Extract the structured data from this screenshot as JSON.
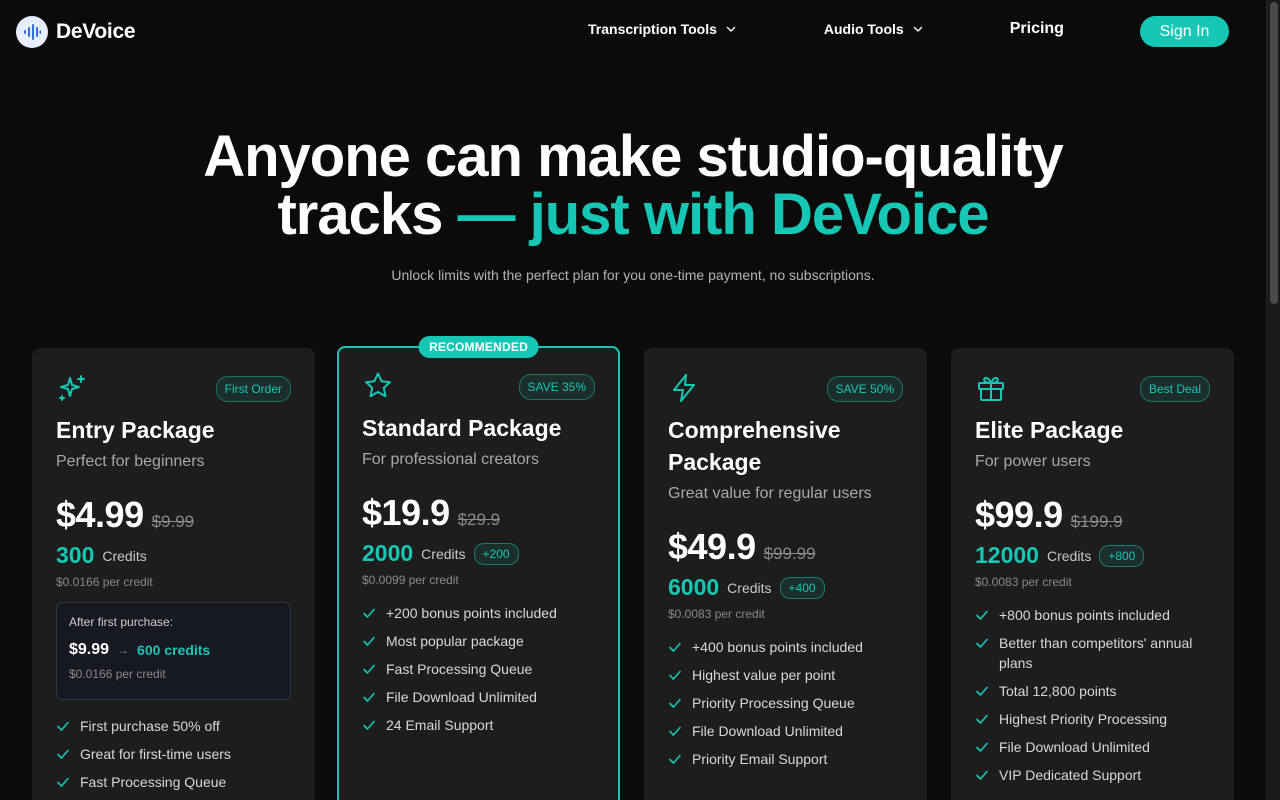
{
  "brand": {
    "name": "DeVoice"
  },
  "nav": {
    "items": [
      {
        "label": "Transcription Tools",
        "has_dropdown": true
      },
      {
        "label": "Audio Tools",
        "has_dropdown": true
      },
      {
        "label": "Pricing",
        "has_dropdown": false
      }
    ],
    "signin_label": "Sign In"
  },
  "hero": {
    "title_line1": "Anyone can make studio-quality",
    "title_line2_plain": "tracks",
    "title_line2_accent": "— just with DeVoice",
    "subtitle": "Unlock limits with the perfect plan for you one-time payment, no subscriptions."
  },
  "colors": {
    "accent": "#15c7b4",
    "background": "#0b0b0b",
    "card": "#1d1d1d"
  },
  "plans": [
    {
      "icon": "sparkles-icon",
      "tag": "First Order",
      "name": "Entry Package",
      "description": "Perfect for beginners",
      "price": "$4.99",
      "old_price": "$9.99",
      "credits": "300",
      "credits_label": "Credits",
      "per_credit": "$0.0166 per credit",
      "after_purchase": {
        "title": "After first purchase:",
        "price": "$9.99",
        "arrow": "→",
        "credits": "600 credits",
        "per_credit": "$0.0166 per credit"
      },
      "features": [
        "First purchase 50% off",
        "Great for first-time users",
        "Fast Processing Queue"
      ]
    },
    {
      "icon": "star-icon",
      "recommended_label": "RECOMMENDED",
      "tag": "SAVE 35%",
      "name": "Standard Package",
      "description": "For professional creators",
      "price": "$19.9",
      "old_price": "$29.9",
      "credits": "2000",
      "credits_label": "Credits",
      "bonus": "+200",
      "per_credit": "$0.0099 per credit",
      "features": [
        "+200 bonus points included",
        "Most popular package",
        "Fast Processing Queue",
        "File Download Unlimited",
        "24 Email Support"
      ]
    },
    {
      "icon": "lightning-icon",
      "tag": "SAVE 50%",
      "name_line1": "Comprehensive",
      "name_line2": "Package",
      "description": "Great value for regular users",
      "price": "$49.9",
      "old_price": "$99.99",
      "credits": "6000",
      "credits_label": "Credits",
      "bonus": "+400",
      "per_credit": "$0.0083 per credit",
      "features": [
        "+400 bonus points included",
        "Highest value per point",
        "Priority Processing Queue",
        "File Download Unlimited",
        "Priority Email Support"
      ]
    },
    {
      "icon": "gift-icon",
      "tag": "Best Deal",
      "name": "Elite Package",
      "description": "For power users",
      "price": "$99.9",
      "old_price": "$199.9",
      "credits": "12000",
      "credits_label": "Credits",
      "bonus": "+800",
      "per_credit": "$0.0083 per credit",
      "features": [
        "+800 bonus points included",
        "Better than competitors' annual plans",
        "Total 12,800 points",
        "Highest Priority Processing",
        "File Download Unlimited",
        "VIP Dedicated Support"
      ]
    }
  ]
}
